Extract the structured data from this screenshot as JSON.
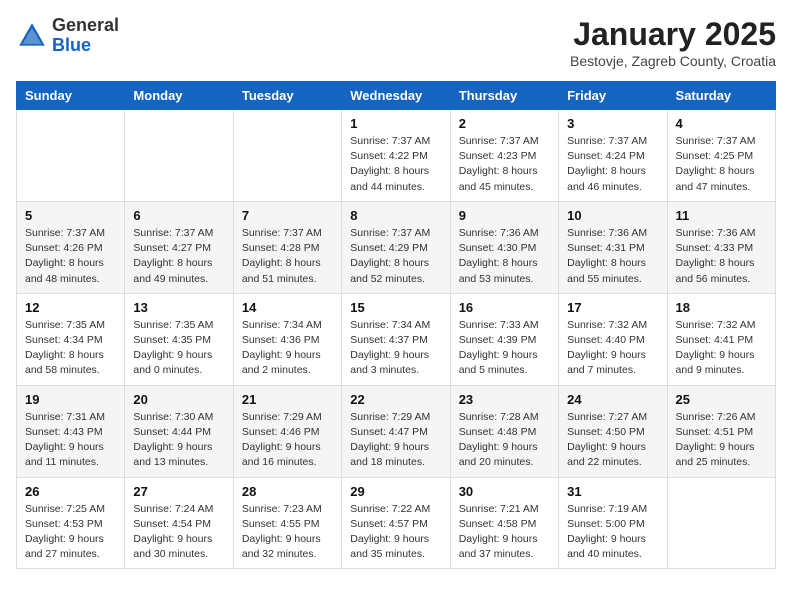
{
  "header": {
    "logo_general": "General",
    "logo_blue": "Blue",
    "month": "January 2025",
    "location": "Bestovje, Zagreb County, Croatia"
  },
  "weekdays": [
    "Sunday",
    "Monday",
    "Tuesday",
    "Wednesday",
    "Thursday",
    "Friday",
    "Saturday"
  ],
  "weeks": [
    [
      {
        "day": "",
        "info": ""
      },
      {
        "day": "",
        "info": ""
      },
      {
        "day": "",
        "info": ""
      },
      {
        "day": "1",
        "info": "Sunrise: 7:37 AM\nSunset: 4:22 PM\nDaylight: 8 hours\nand 44 minutes."
      },
      {
        "day": "2",
        "info": "Sunrise: 7:37 AM\nSunset: 4:23 PM\nDaylight: 8 hours\nand 45 minutes."
      },
      {
        "day": "3",
        "info": "Sunrise: 7:37 AM\nSunset: 4:24 PM\nDaylight: 8 hours\nand 46 minutes."
      },
      {
        "day": "4",
        "info": "Sunrise: 7:37 AM\nSunset: 4:25 PM\nDaylight: 8 hours\nand 47 minutes."
      }
    ],
    [
      {
        "day": "5",
        "info": "Sunrise: 7:37 AM\nSunset: 4:26 PM\nDaylight: 8 hours\nand 48 minutes."
      },
      {
        "day": "6",
        "info": "Sunrise: 7:37 AM\nSunset: 4:27 PM\nDaylight: 8 hours\nand 49 minutes."
      },
      {
        "day": "7",
        "info": "Sunrise: 7:37 AM\nSunset: 4:28 PM\nDaylight: 8 hours\nand 51 minutes."
      },
      {
        "day": "8",
        "info": "Sunrise: 7:37 AM\nSunset: 4:29 PM\nDaylight: 8 hours\nand 52 minutes."
      },
      {
        "day": "9",
        "info": "Sunrise: 7:36 AM\nSunset: 4:30 PM\nDaylight: 8 hours\nand 53 minutes."
      },
      {
        "day": "10",
        "info": "Sunrise: 7:36 AM\nSunset: 4:31 PM\nDaylight: 8 hours\nand 55 minutes."
      },
      {
        "day": "11",
        "info": "Sunrise: 7:36 AM\nSunset: 4:33 PM\nDaylight: 8 hours\nand 56 minutes."
      }
    ],
    [
      {
        "day": "12",
        "info": "Sunrise: 7:35 AM\nSunset: 4:34 PM\nDaylight: 8 hours\nand 58 minutes."
      },
      {
        "day": "13",
        "info": "Sunrise: 7:35 AM\nSunset: 4:35 PM\nDaylight: 9 hours\nand 0 minutes."
      },
      {
        "day": "14",
        "info": "Sunrise: 7:34 AM\nSunset: 4:36 PM\nDaylight: 9 hours\nand 2 minutes."
      },
      {
        "day": "15",
        "info": "Sunrise: 7:34 AM\nSunset: 4:37 PM\nDaylight: 9 hours\nand 3 minutes."
      },
      {
        "day": "16",
        "info": "Sunrise: 7:33 AM\nSunset: 4:39 PM\nDaylight: 9 hours\nand 5 minutes."
      },
      {
        "day": "17",
        "info": "Sunrise: 7:32 AM\nSunset: 4:40 PM\nDaylight: 9 hours\nand 7 minutes."
      },
      {
        "day": "18",
        "info": "Sunrise: 7:32 AM\nSunset: 4:41 PM\nDaylight: 9 hours\nand 9 minutes."
      }
    ],
    [
      {
        "day": "19",
        "info": "Sunrise: 7:31 AM\nSunset: 4:43 PM\nDaylight: 9 hours\nand 11 minutes."
      },
      {
        "day": "20",
        "info": "Sunrise: 7:30 AM\nSunset: 4:44 PM\nDaylight: 9 hours\nand 13 minutes."
      },
      {
        "day": "21",
        "info": "Sunrise: 7:29 AM\nSunset: 4:46 PM\nDaylight: 9 hours\nand 16 minutes."
      },
      {
        "day": "22",
        "info": "Sunrise: 7:29 AM\nSunset: 4:47 PM\nDaylight: 9 hours\nand 18 minutes."
      },
      {
        "day": "23",
        "info": "Sunrise: 7:28 AM\nSunset: 4:48 PM\nDaylight: 9 hours\nand 20 minutes."
      },
      {
        "day": "24",
        "info": "Sunrise: 7:27 AM\nSunset: 4:50 PM\nDaylight: 9 hours\nand 22 minutes."
      },
      {
        "day": "25",
        "info": "Sunrise: 7:26 AM\nSunset: 4:51 PM\nDaylight: 9 hours\nand 25 minutes."
      }
    ],
    [
      {
        "day": "26",
        "info": "Sunrise: 7:25 AM\nSunset: 4:53 PM\nDaylight: 9 hours\nand 27 minutes."
      },
      {
        "day": "27",
        "info": "Sunrise: 7:24 AM\nSunset: 4:54 PM\nDaylight: 9 hours\nand 30 minutes."
      },
      {
        "day": "28",
        "info": "Sunrise: 7:23 AM\nSunset: 4:55 PM\nDaylight: 9 hours\nand 32 minutes."
      },
      {
        "day": "29",
        "info": "Sunrise: 7:22 AM\nSunset: 4:57 PM\nDaylight: 9 hours\nand 35 minutes."
      },
      {
        "day": "30",
        "info": "Sunrise: 7:21 AM\nSunset: 4:58 PM\nDaylight: 9 hours\nand 37 minutes."
      },
      {
        "day": "31",
        "info": "Sunrise: 7:19 AM\nSunset: 5:00 PM\nDaylight: 9 hours\nand 40 minutes."
      },
      {
        "day": "",
        "info": ""
      }
    ]
  ]
}
